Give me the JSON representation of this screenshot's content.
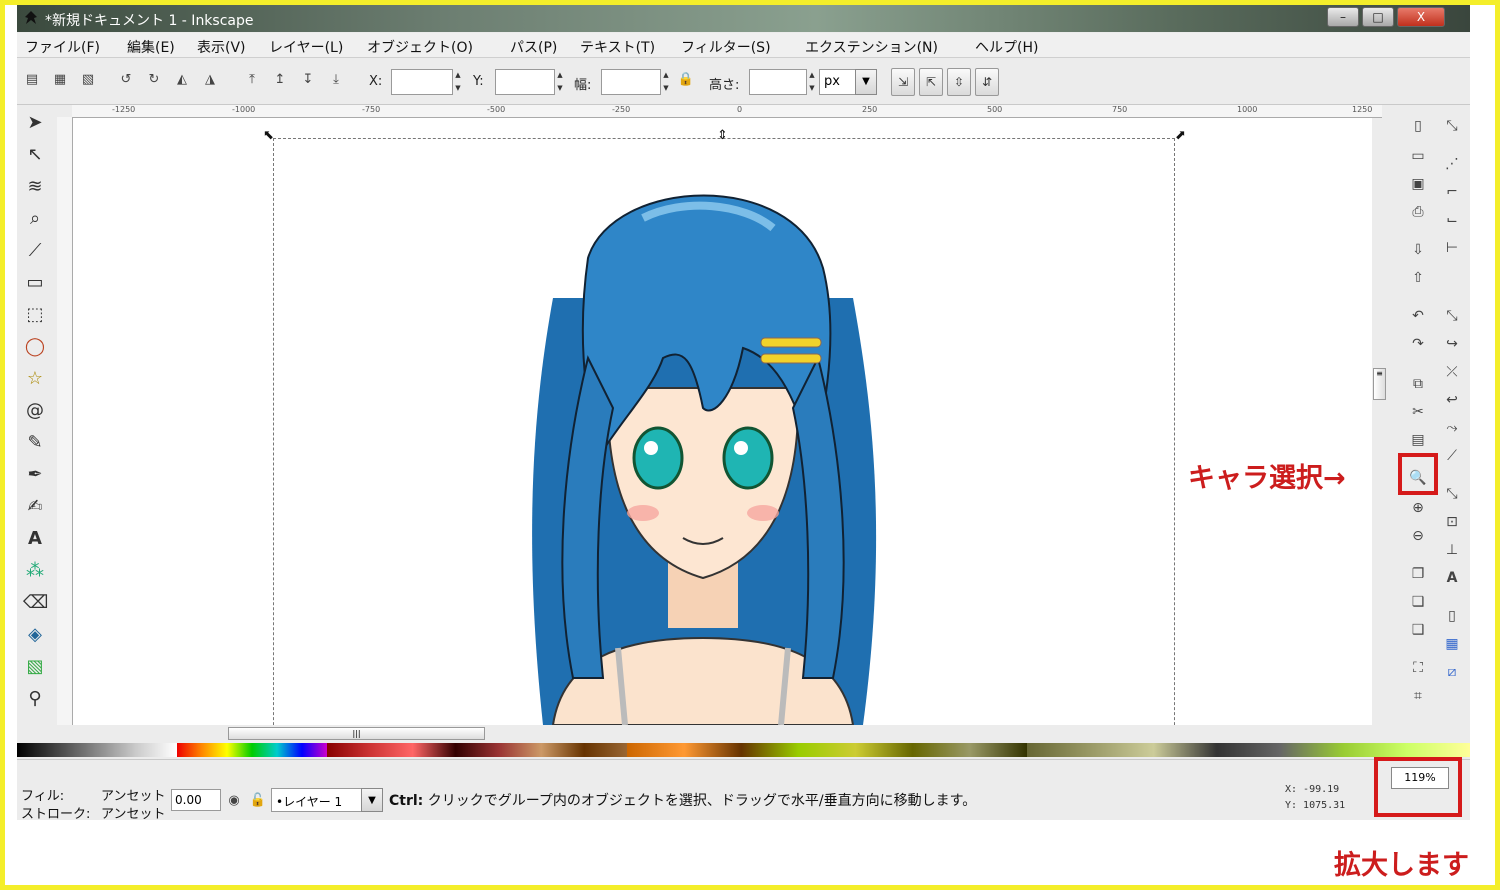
{
  "window": {
    "title": "*新規ドキュメント 1 - Inkscape",
    "btn_min": "–",
    "btn_max": "□",
    "btn_close": "X"
  },
  "menu": [
    "ファイル(F)",
    "編集(E)",
    "表示(V)",
    "レイヤー(L)",
    "オブジェクト(O)",
    "パス(P)",
    "テキスト(T)",
    "フィルター(S)",
    "エクステンション(N)",
    "ヘルプ(H)"
  ],
  "toolbar": {
    "x_label": "X:",
    "y_label": "Y:",
    "w_label": "幅:",
    "h_label": "高さ:",
    "unit": "px",
    "x_value": "",
    "y_value": "",
    "w_value": "",
    "h_value": ""
  },
  "ruler_labels": [
    "-1250",
    "-1000",
    "-750",
    "-500",
    "-250",
    "0",
    "250",
    "500",
    "750",
    "1000",
    "1250"
  ],
  "status": {
    "fill_label": "フィル:",
    "fill_value": "アンセット",
    "stroke_label": "ストローク:",
    "stroke_value": "アンセット",
    "opacity": "0.00",
    "layer": "•レイヤー 1",
    "message_key": "Ctrl:",
    "message": "クリックでグループ内のオブジェクトを選択、ドラッグで水平/垂直方向に移動します。",
    "x_coord": "X:   -99.19",
    "y_coord": "Y: 1075.31",
    "zoom": "119%"
  },
  "annotations": {
    "select_char": "キャラ選択→",
    "zoom_in": "拡大します"
  },
  "colors": {
    "frame": "#f4ee2a",
    "annotation_red": "#d51a1a",
    "hair": "#2f86c8"
  },
  "icons": {
    "left_tools": [
      "selector-arrow-icon",
      "node-tool-icon",
      "tweak-tool-icon",
      "zoom-tool-icon",
      "measure-tool-icon",
      "rectangle-tool-icon",
      "3d-box-tool-icon",
      "ellipse-tool-icon",
      "star-tool-icon",
      "spiral-tool-icon",
      "pencil-tool-icon",
      "pen-tool-icon",
      "calligraphy-tool-icon",
      "text-tool-icon",
      "spray-tool-icon",
      "eraser-tool-icon",
      "paint-bucket-icon",
      "gradient-tool-icon",
      "dropper-tool-icon"
    ],
    "commands": [
      "new-document-icon",
      "open-icon",
      "save-icon",
      "print-icon",
      "import-icon",
      "export-icon",
      "undo-icon",
      "redo-icon",
      "copy-icon",
      "paste-icon",
      "zoom-selection-icon",
      "zoom-drawing-icon",
      "zoom-page-icon",
      "duplicate-icon",
      "clone-icon",
      "unlink-clone-icon",
      "group-icon",
      "ungroup-icon"
    ]
  }
}
